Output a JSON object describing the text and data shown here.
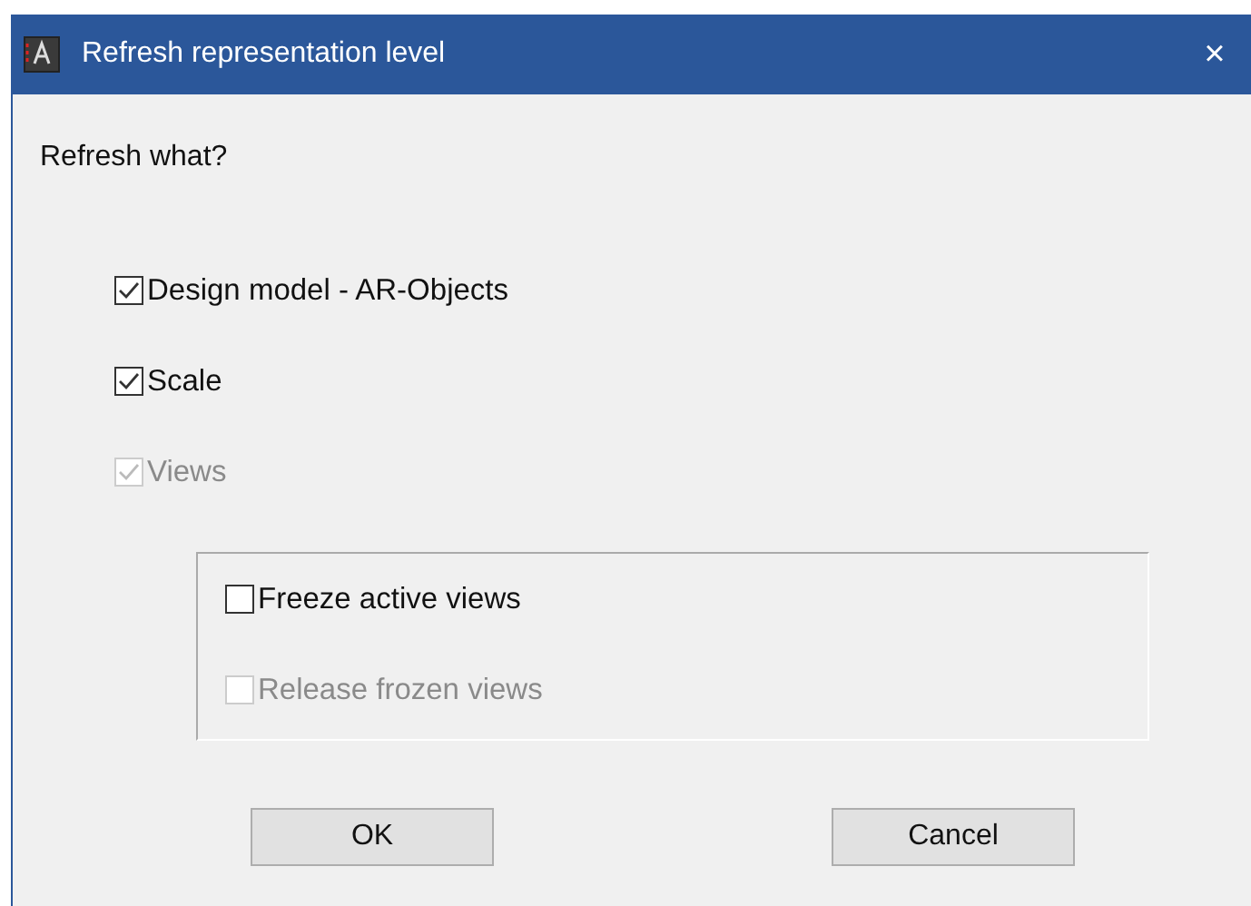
{
  "window": {
    "title": "Refresh representation level",
    "close": "×"
  },
  "prompt": "Refresh what?",
  "options": [
    {
      "label": "Design model - AR-Objects",
      "checked": true,
      "disabled": false
    },
    {
      "label": "Scale",
      "checked": true,
      "disabled": false
    },
    {
      "label": "Views",
      "checked": true,
      "disabled": true
    }
  ],
  "group": [
    {
      "label": "Freeze active views",
      "checked": false,
      "disabled": false
    },
    {
      "label": "Release frozen views",
      "checked": false,
      "disabled": true
    }
  ],
  "buttons": [
    "OK",
    "Cancel"
  ]
}
